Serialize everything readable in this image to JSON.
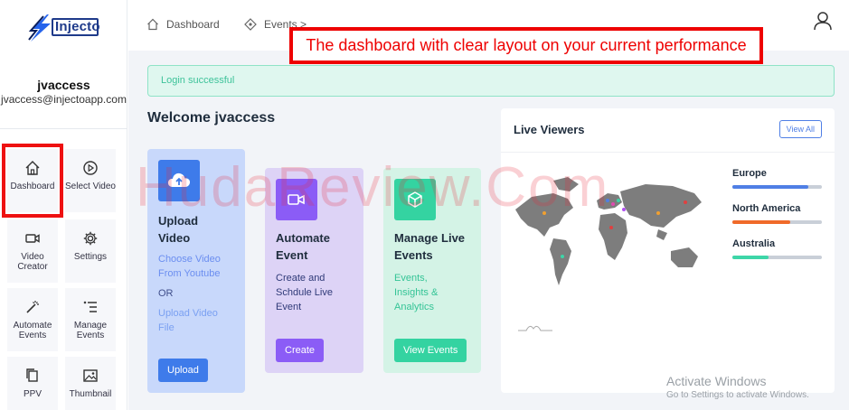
{
  "app": {
    "logo_text": "Injecto"
  },
  "profile": {
    "name": "jvaccess",
    "email": "jvaccess@injectoapp.com"
  },
  "nav": {
    "items": [
      {
        "label": "Dashboard",
        "icon": "home-icon"
      },
      {
        "label": "Select Video",
        "icon": "play-circle-icon"
      },
      {
        "label": "Video Creator",
        "icon": "video-camera-icon"
      },
      {
        "label": "Settings",
        "icon": "gear-icon"
      },
      {
        "label": "Automate Events",
        "icon": "magic-wand-icon"
      },
      {
        "label": "Manage Events",
        "icon": "list-icon"
      },
      {
        "label": "PPV",
        "icon": "copy-icon"
      },
      {
        "label": "Thumbnail",
        "icon": "image-icon"
      }
    ]
  },
  "breadcrumb": {
    "home": "Dashboard",
    "events": "Events >"
  },
  "annotation": {
    "banner": "The dashboard with clear layout on your current performance"
  },
  "alert": {
    "message": "Login successful"
  },
  "welcome": {
    "title": "Welcome jvaccess"
  },
  "cards": {
    "upload": {
      "title": "Upload Video",
      "link1": "Choose Video From Youtube",
      "or": "OR",
      "link2": "Upload Video File",
      "button": "Upload"
    },
    "automate": {
      "title": "Automate Event",
      "text": "Create and Schdule Live Event",
      "button": "Create"
    },
    "manage": {
      "title": "Manage Live Events",
      "text": "Events, Insights & Analytics",
      "button": "View Events"
    }
  },
  "viewers": {
    "title": "Live Viewers",
    "view_all": "View All",
    "regions": [
      {
        "name": "Europe",
        "share": 0.85,
        "color": "#4f7fe5"
      },
      {
        "name": "North America",
        "share": 0.65,
        "color": "#f06a2a"
      },
      {
        "name": "Australia",
        "share": 0.4,
        "color": "#3ed6a8"
      }
    ]
  },
  "watermark": "HudaReview.Com",
  "os_watermark": {
    "line1": "Activate Windows",
    "line2": "Go to Settings to activate Windows."
  }
}
